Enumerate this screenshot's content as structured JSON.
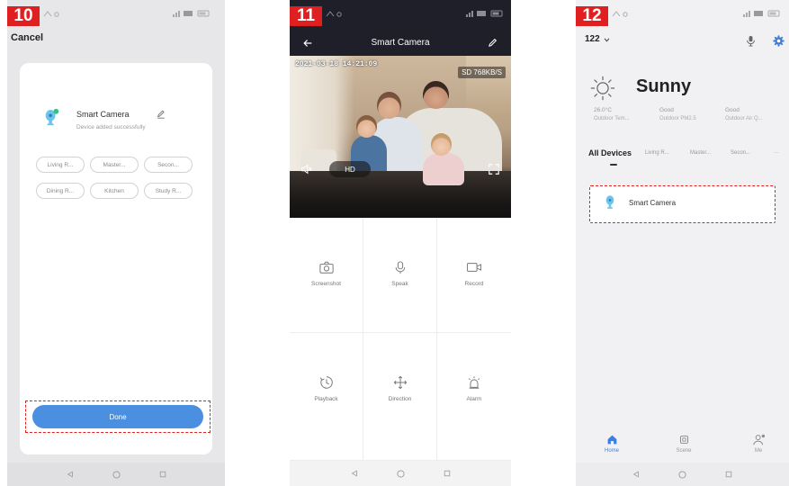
{
  "colors": {
    "step_label": "#e02020",
    "accent": "#4a8fe0",
    "accent_nav": "#3d7fe0",
    "highlight": "#e02020",
    "header_dark": "#1e1f29"
  },
  "panel10": {
    "step": "10",
    "cancel": "Cancel",
    "device_name": "Smart Camera",
    "device_status": "Device added successfully",
    "rooms": [
      "Living R...",
      "Master...",
      "Secon...",
      "Dining R...",
      "Kitchen",
      "Study R..."
    ],
    "done": "Done"
  },
  "panel11": {
    "step": "11",
    "title": "Smart Camera",
    "timestamp": "2021-03-18 14:21:09",
    "bitrate": "SD 768KB/S",
    "quality": "HD",
    "controls": [
      {
        "label": "Screenshot",
        "icon": "screenshot-icon"
      },
      {
        "label": "Speak",
        "icon": "mic-icon"
      },
      {
        "label": "Record",
        "icon": "record-icon"
      },
      {
        "label": "Playback",
        "icon": "playback-icon"
      },
      {
        "label": "Direction",
        "icon": "direction-icon"
      },
      {
        "label": "Alarm",
        "icon": "alarm-icon"
      }
    ]
  },
  "panel12": {
    "step": "12",
    "home_name": "122",
    "weather": {
      "condition": "Sunny",
      "stats": [
        {
          "value": "26.0°C",
          "label": "Outdoor Tem..."
        },
        {
          "value": "Good",
          "label": "Outdoor PM2.5"
        },
        {
          "value": "Good",
          "label": "Outdoor Air Q..."
        }
      ]
    },
    "tabs": [
      "All Devices",
      "Living R...",
      "Master...",
      "Secon...",
      "···"
    ],
    "device_name": "Smart Camera",
    "nav": [
      "Home",
      "Scene",
      "Me"
    ]
  }
}
